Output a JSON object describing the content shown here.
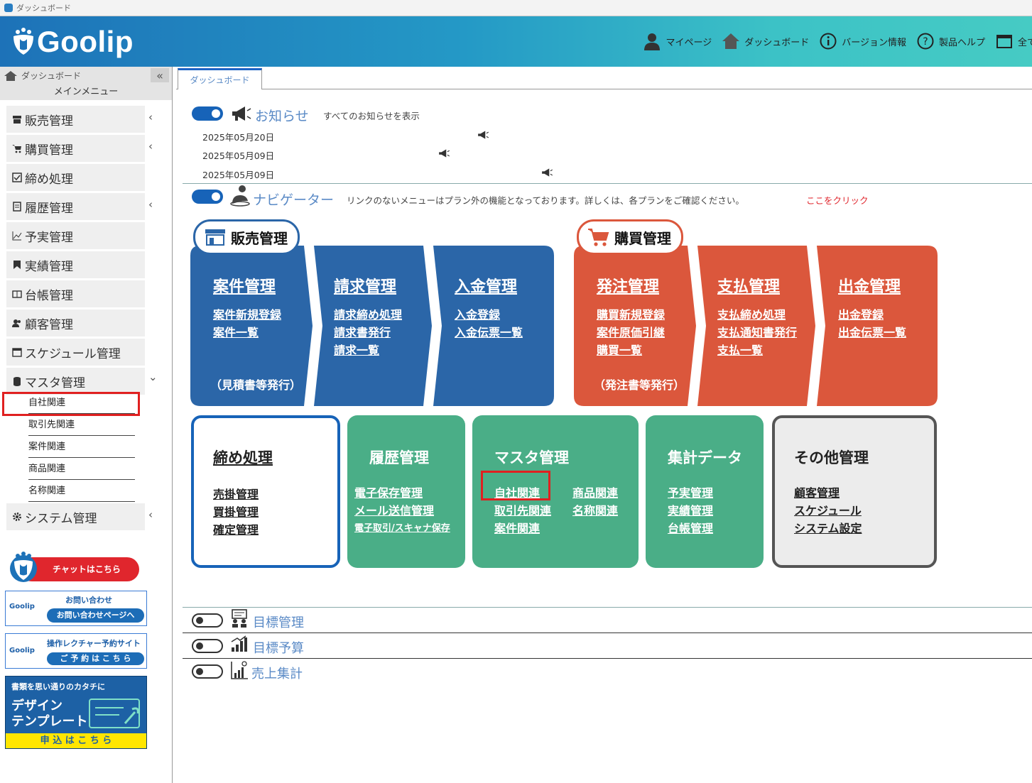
{
  "window": {
    "title": "ダッシュボード"
  },
  "header": {
    "logo_text": "Goolip",
    "nav": [
      {
        "label": "マイページ",
        "icon": "person-icon"
      },
      {
        "label": "ダッシュボード",
        "icon": "home-icon"
      },
      {
        "label": "バージョン情報",
        "icon": "info-icon"
      },
      {
        "label": "製品ヘルプ",
        "icon": "help-icon"
      },
      {
        "label": "全て",
        "icon": "window-icon"
      }
    ]
  },
  "sidebar": {
    "breadcrumb": "ダッシュボード",
    "collapse_label": "«",
    "menu_title": "メインメニュー",
    "items": [
      {
        "label": "販売管理",
        "chevron": "‹"
      },
      {
        "label": "購買管理",
        "chevron": "‹"
      },
      {
        "label": "締め処理",
        "chevron": ""
      },
      {
        "label": "履歴管理",
        "chevron": "‹"
      },
      {
        "label": "予実管理",
        "chevron": ""
      },
      {
        "label": "実績管理",
        "chevron": ""
      },
      {
        "label": "台帳管理",
        "chevron": ""
      },
      {
        "label": "顧客管理",
        "chevron": ""
      },
      {
        "label": "スケジュール管理",
        "chevron": ""
      },
      {
        "label": "マスタ管理",
        "chevron": "⌄"
      }
    ],
    "sub_items": [
      "自社関連",
      "取引先関連",
      "案件関連",
      "商品関連",
      "名称関連"
    ],
    "system_item": {
      "label": "システム管理",
      "chevron": "‹"
    },
    "chat_label": "チャットはこちら",
    "contact": {
      "logo": "Goolip",
      "title": "お問い合わせ",
      "button": "お問い合わせページへ"
    },
    "lecture": {
      "logo": "Goolip",
      "title": "操作レクチャー予約サイト",
      "button": "ご 予 約 は こ ち ら"
    },
    "template": {
      "top": "書類を思い通りのカタチに",
      "line1": "デザイン",
      "line2": "テンプレート",
      "bottom": "申 込 は こ ち ら"
    }
  },
  "tabs": [
    {
      "label": "ダッシュボード",
      "active": true
    }
  ],
  "notices": {
    "title": "お知らせ",
    "show_all": "すべてのお知らせを表示",
    "items": [
      {
        "date": "2025年05月20日"
      },
      {
        "date": "2025年05月09日"
      },
      {
        "date": "2025年05月09日"
      }
    ]
  },
  "navigator": {
    "title": "ナビゲーター",
    "note": "リンクのないメニューはプラン外の機能となっております。詳しくは、各プランをご確認ください。",
    "click_here": "ここをクリック",
    "sales": {
      "badge": "販売管理",
      "color": "#2b66a8",
      "columns": [
        {
          "title": "案件管理",
          "links": [
            "案件新規登録",
            "案件一覧"
          ],
          "note": "（見積書等発行）"
        },
        {
          "title": "請求管理",
          "links": [
            "請求締め処理",
            "請求書発行",
            "請求一覧"
          ],
          "note": ""
        },
        {
          "title": "入金管理",
          "links": [
            "入金登録",
            "入金伝票一覧"
          ],
          "note": ""
        }
      ]
    },
    "purchase": {
      "badge": "購買管理",
      "color": "#db573c",
      "columns": [
        {
          "title": "発注管理",
          "links": [
            "購買新規登録",
            "案件原価引継",
            "購買一覧"
          ],
          "note": "（発注書等発行）"
        },
        {
          "title": "支払管理",
          "links": [
            "支払締め処理",
            "支払通知書発行",
            "支払一覧"
          ],
          "note": ""
        },
        {
          "title": "出金管理",
          "links": [
            "出金登録",
            "出金伝票一覧"
          ],
          "note": ""
        }
      ]
    },
    "boxes": {
      "closing": {
        "title": "締め処理",
        "links": [
          "売掛管理",
          "買掛管理",
          "確定管理"
        ]
      },
      "history": {
        "title": "履歴管理",
        "links": [
          "電子保存管理",
          "メール送信管理",
          "電子取引/スキャナ保存"
        ]
      },
      "master": {
        "title": "マスタ管理",
        "links": [
          "自社関連",
          "取引先関連",
          "案件関連",
          "商品関連",
          "名称関連"
        ]
      },
      "aggregate": {
        "title": "集計データ",
        "links": [
          "予実管理",
          "実績管理",
          "台帳管理"
        ]
      },
      "other": {
        "title": "その他管理",
        "links": [
          "顧客管理",
          "スケジュール",
          "システム設定"
        ]
      }
    }
  },
  "bottom_sections": [
    {
      "label": "目標管理"
    },
    {
      "label": "目標予算"
    },
    {
      "label": "売上集計"
    }
  ],
  "colors": {
    "sales_blue": "#2b66a8",
    "purchase_red": "#db573c",
    "teal": "#4aae87",
    "highlight_red": "#e02020",
    "link_red": "#e0262d"
  }
}
